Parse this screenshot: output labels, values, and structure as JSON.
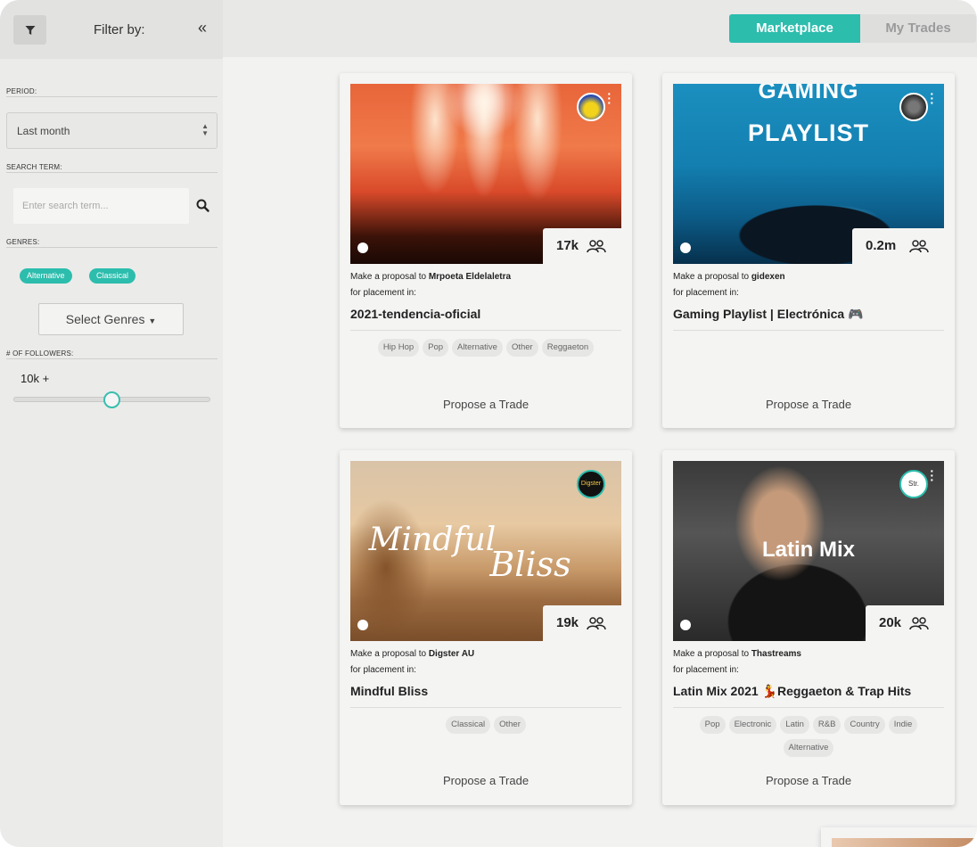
{
  "sidebar": {
    "title": "Filter by:",
    "period_label": "PERIOD:",
    "period_value": "Last month",
    "search_label": "SEARCH TERM:",
    "search_placeholder": "Enter search term...",
    "genres_label": "GENRES:",
    "selected_genres": [
      "Alternative",
      "Classical"
    ],
    "select_genres_button": "Select Genres",
    "followers_label": "# OF FOLLOWERS:",
    "followers_value": "10k +",
    "slider_fraction": 0.5
  },
  "tabs": {
    "marketplace": "Marketplace",
    "my_trades": "My Trades"
  },
  "cards": [
    {
      "image_text": "",
      "followers": "17k",
      "proposal_prefix": "Make a proposal to ",
      "curator": "Mrpoeta Eldelaletra",
      "placement": "for placement in:",
      "playlist": "2021-tendencia-oficial",
      "tags": [
        "Hip Hop",
        "Pop",
        "Alternative",
        "Other",
        "Reggaeton"
      ],
      "action": "Propose a Trade"
    },
    {
      "image_text_1": "GAMING",
      "image_text_2": "PLAYLIST",
      "followers": "0.2m",
      "proposal_prefix": "Make a proposal to ",
      "curator": "gidexen",
      "placement": "for placement in:",
      "playlist": "Gaming Playlist | Electrónica 🎮",
      "tags": [],
      "action": "Propose a Trade"
    },
    {
      "image_text_1": "Mindful",
      "image_text_2": "Bliss",
      "avatar_label": "Digster",
      "followers": "19k",
      "proposal_prefix": "Make a proposal to ",
      "curator": "Digster AU",
      "placement": "for placement in:",
      "playlist": "Mindful Bliss",
      "tags": [
        "Classical",
        "Other"
      ],
      "action": "Propose a Trade"
    },
    {
      "image_text": "Latin Mix",
      "avatar_label": "Str.",
      "followers": "20k",
      "proposal_prefix": "Make a proposal to ",
      "curator": "Thastreams",
      "placement": "for placement in:",
      "playlist": "Latin Mix 2021 💃Reggaeton & Trap Hits",
      "tags": [
        "Pop",
        "Electronic",
        "Latin",
        "R&B",
        "Country",
        "Indie",
        "Alternative"
      ],
      "action": "Propose a Trade"
    }
  ],
  "colors": {
    "accent": "#2cbdad"
  }
}
